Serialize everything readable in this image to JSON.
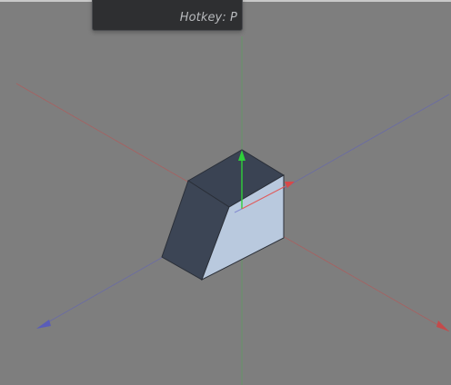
{
  "tooltip": {
    "hotkey": "Hotkey: P"
  },
  "colors": {
    "background": "#7e7e7e",
    "tooltip_background": "#2e2f31",
    "axis_x": "#c04848",
    "axis_y": "#2fbf3a",
    "axis_z": "#5d5fb8",
    "face_dark": "#3b4454",
    "face_light": "#b7c8dd"
  }
}
